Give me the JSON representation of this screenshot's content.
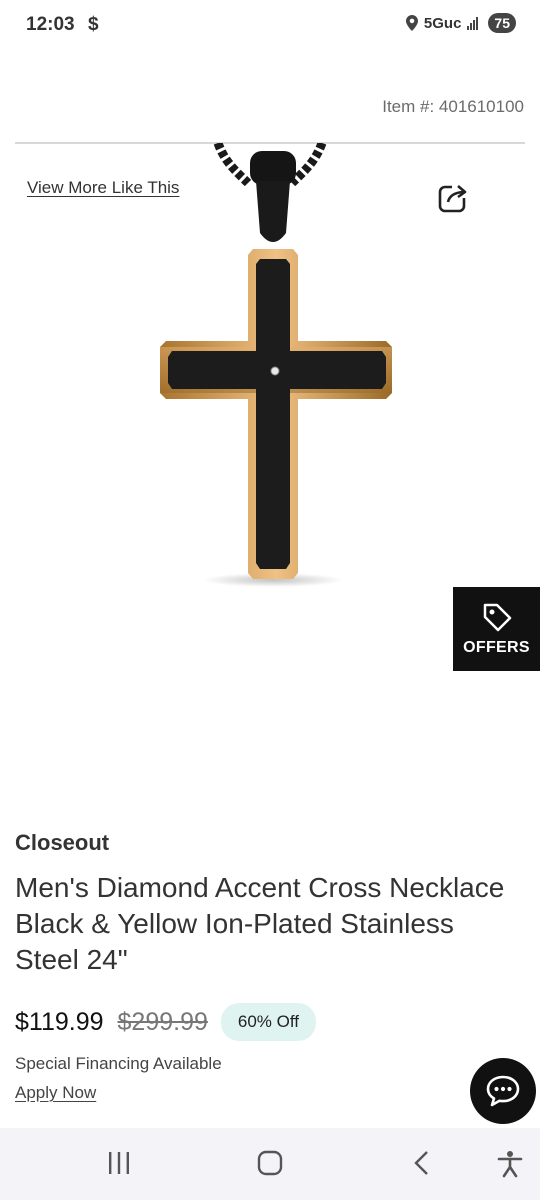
{
  "status_bar": {
    "time": "12:03",
    "dollar_icon_text": "$",
    "network": "5Guc",
    "battery": "75"
  },
  "product": {
    "item_number": "Item #: 401610100",
    "view_more_link": "View More Like This",
    "badge": "Closeout",
    "title": "Men's Diamond Accent Cross Necklace Black & Yellow Ion-Plated Stainless Steel 24\"",
    "price": "$119.99",
    "original_price": "$299.99",
    "discount": "60% Off",
    "financing_text": "Special Financing Available",
    "apply_link": "Apply Now"
  },
  "offers": {
    "label": "OFFERS"
  },
  "icons": {
    "share": "share-icon",
    "offers": "tag-icon",
    "chat": "chat-icon",
    "location": "location-icon",
    "recents": "recents-icon",
    "home": "home-icon",
    "back": "back-icon",
    "accessibility": "accessibility-icon"
  },
  "colors": {
    "discount_badge_bg": "#dff3f1",
    "offers_bg": "#111111",
    "nav_bg": "#f4f4f8"
  }
}
